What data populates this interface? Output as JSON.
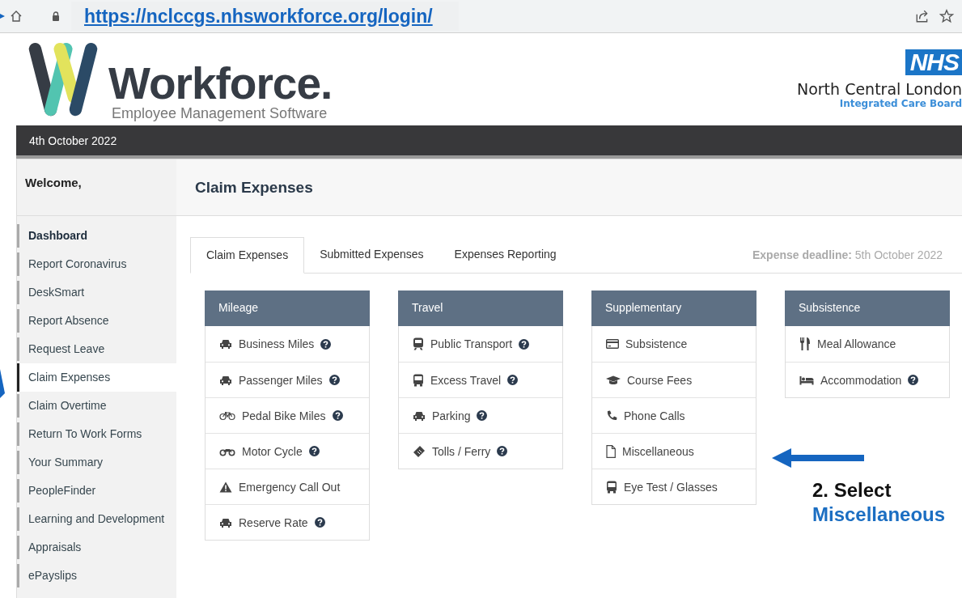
{
  "browser": {
    "url": "https://nclccgs.nhsworkforce.org/login/"
  },
  "header": {
    "brand": "Workforce.",
    "tagline": "Employee Management Software",
    "nhs_badge": "NHS",
    "org_name": "North Central London",
    "org_sub": "Integrated Care Board"
  },
  "date_bar": {
    "date": "4th October 2022"
  },
  "sidebar": {
    "welcome": "Welcome,",
    "items": [
      {
        "label": "Dashboard",
        "bold": true,
        "selected": false
      },
      {
        "label": "Report Coronavirus",
        "bold": false,
        "selected": false
      },
      {
        "label": "DeskSmart",
        "bold": false,
        "selected": false
      },
      {
        "label": "Report Absence",
        "bold": false,
        "selected": false
      },
      {
        "label": "Request Leave",
        "bold": false,
        "selected": false
      },
      {
        "label": "Claim Expenses",
        "bold": false,
        "selected": true
      },
      {
        "label": "Claim Overtime",
        "bold": false,
        "selected": false
      },
      {
        "label": "Return To Work Forms",
        "bold": false,
        "selected": false
      },
      {
        "label": "Your Summary",
        "bold": false,
        "selected": false
      },
      {
        "label": "PeopleFinder",
        "bold": false,
        "selected": false
      },
      {
        "label": "Learning and Development",
        "bold": false,
        "selected": false
      },
      {
        "label": "Appraisals",
        "bold": false,
        "selected": false
      },
      {
        "label": "ePayslips",
        "bold": false,
        "selected": false
      }
    ]
  },
  "page_title": "Claim Expenses",
  "tabs": [
    {
      "label": "Claim Expenses",
      "selected": true
    },
    {
      "label": "Submitted Expenses",
      "selected": false
    },
    {
      "label": "Expenses Reporting",
      "selected": false
    }
  ],
  "deadline": {
    "label": "Expense deadline:",
    "date": "5th October 2022"
  },
  "panels": [
    {
      "title": "Mileage",
      "items": [
        {
          "label": "Business Miles",
          "kind": "car",
          "help": true
        },
        {
          "label": "Passenger Miles",
          "kind": "car",
          "help": true
        },
        {
          "label": "Pedal Bike Miles",
          "kind": "bicycle",
          "help": true
        },
        {
          "label": "Motor Cycle",
          "kind": "motorcycle",
          "help": true
        },
        {
          "label": "Emergency Call Out",
          "kind": "warning",
          "help": false
        },
        {
          "label": "Reserve Rate",
          "kind": "car",
          "help": true
        }
      ]
    },
    {
      "title": "Travel",
      "items": [
        {
          "label": "Public Transport",
          "kind": "train",
          "help": true
        },
        {
          "label": "Excess Travel",
          "kind": "bus",
          "help": true
        },
        {
          "label": "Parking",
          "kind": "car",
          "help": true
        },
        {
          "label": "Tolls / Ferry",
          "kind": "ticket",
          "help": true
        }
      ]
    },
    {
      "title": "Supplementary",
      "items": [
        {
          "label": "Subsistence",
          "kind": "card",
          "help": false
        },
        {
          "label": "Course Fees",
          "kind": "cap",
          "help": false
        },
        {
          "label": "Phone Calls",
          "kind": "phone",
          "help": false
        },
        {
          "label": "Miscellaneous",
          "kind": "file",
          "help": false
        },
        {
          "label": "Eye Test / Glasses",
          "kind": "bus",
          "help": false
        }
      ]
    },
    {
      "title": "Subsistence",
      "items": [
        {
          "label": "Meal Allowance",
          "kind": "cutlery",
          "help": false
        },
        {
          "label": "Accommodation",
          "kind": "bed",
          "help": true
        }
      ]
    }
  ],
  "annotation": {
    "step": "2. Select",
    "target": "Miscellaneous"
  }
}
